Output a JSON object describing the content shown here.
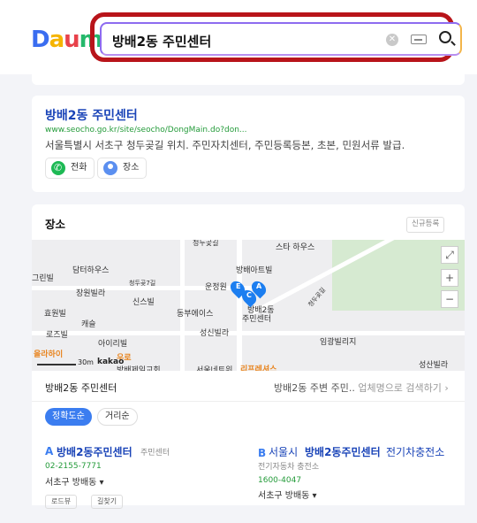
{
  "header": {
    "logo": "Daum",
    "search_value": "방배2동 주민센터"
  },
  "result": {
    "title": "방배2동 주민센터",
    "url": "www.seocho.go.kr/site/seocho/DongMain.do?don...",
    "description": "서울특별시 서초구 청두곶길 위치. 주민자치센터, 주민등록등본, 초본, 민원서류 발급.",
    "chip_phone": "전화",
    "chip_place": "장소"
  },
  "place": {
    "heading": "장소",
    "new_register": "신규등록",
    "map_labels": [
      "청두곶길",
      "스타 하우스",
      "그린빌",
      "담터하우스",
      "청두곶7길",
      "장원빌라",
      "방배아트빌",
      "운정원",
      "신스빌",
      "효원빌",
      "동부에이스",
      "방배2동",
      "주민센터",
      "캐슬",
      "로즈빌",
      "성신빌라",
      "아이리빌",
      "임광빌리지",
      "올라하이",
      "우로",
      "리프레셔스",
      "성산빌라",
      "방배제일교회",
      "서울네트워",
      "청두곶길"
    ],
    "map_markers": [
      "E",
      "C",
      "A"
    ],
    "scale_label": "30m",
    "kakao_label": "kakao",
    "zoom_in": "+",
    "zoom_out": "−",
    "list_title": "방배2동 주민센터",
    "list_nearby": "방배2동 주변 주민..",
    "list_search_hint": "업체명으로 검색하기 ›",
    "sort_accuracy": "정확도순",
    "sort_distance": "거리순",
    "items": [
      {
        "letter": "A",
        "name": "방배2동주민센터",
        "category": "주민센터",
        "phone": "02-2155-7771",
        "area": "서초구 방배동 ▾"
      },
      {
        "letter": "B",
        "name_prefix": "서울시",
        "name": "방배2동주민센터",
        "name_suffix": "전기차충전소",
        "category": "전기자동차 충전소",
        "phone": "1600-4047",
        "area": "서초구 방배동 ▾"
      }
    ],
    "btn_route": "로드뷰",
    "btn_share": "길찾기"
  }
}
